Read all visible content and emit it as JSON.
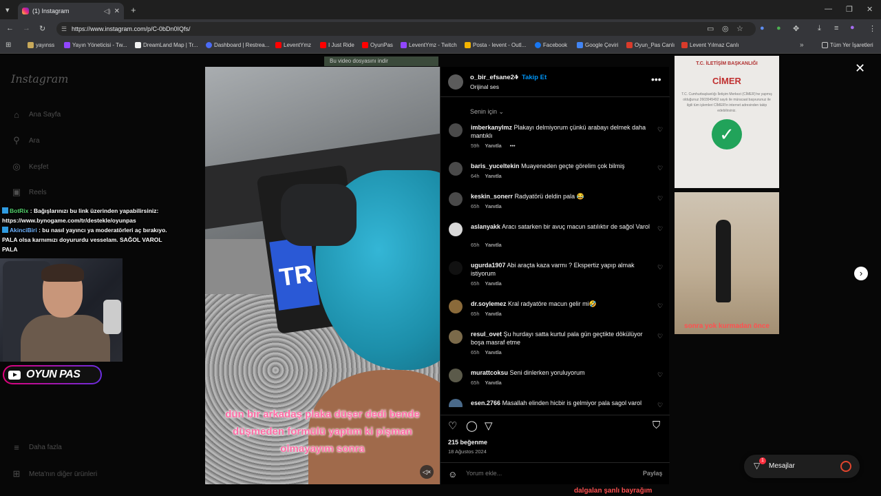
{
  "browser": {
    "tab_title": "(1) Instagram",
    "url": "https://www.instagram.com/p/C-0bDn0IQfs/",
    "bookmarks": [
      {
        "label": "yayınss",
        "color": "#c8a95a"
      },
      {
        "label": "Yayın Yöneticisi - Tw...",
        "color": "#9146ff"
      },
      {
        "label": "DreamLand Map | Tr...",
        "color": "#f2f2f2"
      },
      {
        "label": "Dashboard | Restrea...",
        "color": "#4b6bf5"
      },
      {
        "label": "LeventYmz",
        "color": "#ff0000"
      },
      {
        "label": "I Just Ride",
        "color": "#ff0000"
      },
      {
        "label": "OyunPas",
        "color": "#ff0000"
      },
      {
        "label": "LeventYmz - Twitch",
        "color": "#9146ff"
      },
      {
        "label": "Posta - levent - Outl...",
        "color": "#f4b400"
      },
      {
        "label": "Facebook",
        "color": "#1877f2"
      },
      {
        "label": "Google Çeviri",
        "color": "#4285f4"
      },
      {
        "label": "Oyun_Pas Canlı",
        "color": "#d93b2b"
      },
      {
        "label": "Levent Yılmaz Canlı",
        "color": "#d93b2b"
      }
    ],
    "all_bookmarks": "Tüm Yer İşaretleri"
  },
  "sidebar": {
    "logo": "Instagram",
    "items": [
      {
        "label": "Ana Sayfa",
        "icon": "home-icon"
      },
      {
        "label": "Ara",
        "icon": "search-icon"
      },
      {
        "label": "Keşfet",
        "icon": "compass-icon"
      },
      {
        "label": "Reels",
        "icon": "reels-icon"
      },
      {
        "label": "Daha fazla",
        "icon": "menu-icon"
      },
      {
        "label": "Meta'nın diğer ürünleri",
        "icon": "meta-grid-icon"
      }
    ]
  },
  "stream_overlay": {
    "chat": [
      {
        "user": "BotRix",
        "message": ": Bağışlarınızı bu link üzerinden yapabilirsiniz: https://www.bynogame.com/tr/destekle/oyunpas"
      },
      {
        "user": "AkinciBiri",
        "message": ": bu nasıl yayıncı ya moderatörleri aç bırakıyo. PALA olsa karnımızı doyururdu vesselam. SAĞOL VAROL PALA"
      }
    ],
    "channel_badge": "OYUN PAS"
  },
  "popup_label": "Bu video dosyasını indir",
  "post": {
    "video_caption": "dün bir arkadaş plaka düşer dedi bende düşmeden formülü yaptım ki pişman olmayayım sonra",
    "author": "o_bir_efsane24",
    "follow_label": "Takip Et",
    "audio": "Orijinal ses",
    "sort_label": "Senin için",
    "comments": [
      {
        "user": "imberkanylmz",
        "text": "Plakayı delmiyorum çünkü arabayı delmek daha mantıklı",
        "time": "59h",
        "reply": "Yanıtla",
        "more": "•••"
      },
      {
        "user": "baris_yuceltekin",
        "text": "Muayeneden geçte görelim çok bilmiş",
        "time": "64h",
        "reply": "Yanıtla",
        "more": ""
      },
      {
        "user": "keskin_sonerr",
        "text": "Radyatörü deldin pala 😂",
        "time": "65h",
        "reply": "Yanıtla",
        "more": ""
      },
      {
        "user": "aslanyakk",
        "text": "Aracı satarken bir avuç macun satılıktır de sağol Varol",
        "time": "65h",
        "reply": "Yanıtla",
        "more": ""
      },
      {
        "user": "ugurda1907",
        "text": "Abi araçta kaza varmı ? Ekspertiz yapıp almak istiyorum",
        "time": "65h",
        "reply": "Yanıtla",
        "more": ""
      },
      {
        "user": "dr.soylemez",
        "text": "Kral radyatöre macun gelir mi🤣",
        "time": "65h",
        "reply": "Yanıtla",
        "more": ""
      },
      {
        "user": "resul_ovet",
        "text": "Şu hurdayı satta kurtul pala gün geçtikte dökülüyor boşa masraf etme",
        "time": "65h",
        "reply": "Yanıtla",
        "more": ""
      },
      {
        "user": "murattcoksu",
        "text": "Seni dinlerken yoruluyorum",
        "time": "65h",
        "reply": "Yanıtla",
        "more": ""
      },
      {
        "user": "esen.2766",
        "text": "Masallah elinden hicbir is gelmiyor pala sagol varol",
        "time": "",
        "reply": "",
        "more": ""
      }
    ],
    "likes": "215 beğenme",
    "date": "18 Ağustos 2024",
    "comment_placeholder": "Yorum ekle...",
    "share_label": "Paylaş"
  },
  "side_content": {
    "cimer_header": "T.C. İLETİŞİM BAŞKANLIĞI",
    "cimer_title": "CİMER",
    "cimer_text": "T.C. Cumhurbaşkanlığı İletişim Merkezi (CİMER)'ne yapmış olduğunuz 2603945492 sayılı ile müracaat başvurunuz ile ilgili tüm işlemleri CİMER'in internet adresinden takip edebilirsiniz.",
    "photo_caption": "sonra yok kurmadan önce",
    "bottom_caption": "dalgalan şanlı bayrağım"
  },
  "messages": {
    "label": "Mesajlar",
    "badge": "1"
  }
}
